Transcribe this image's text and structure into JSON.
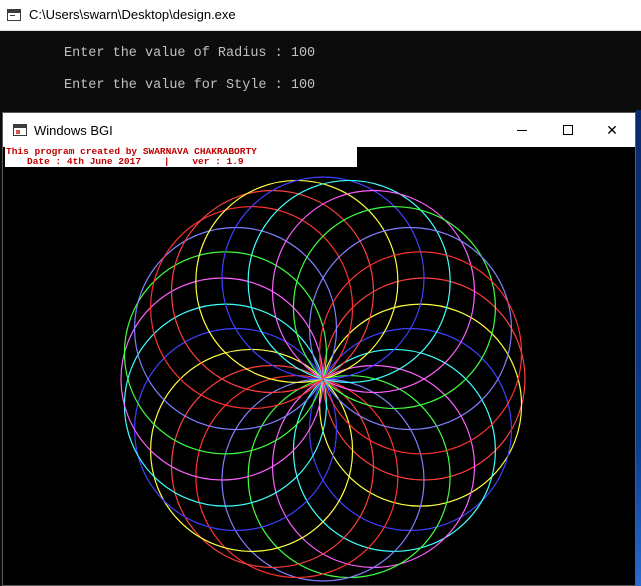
{
  "console": {
    "title": "C:\\Users\\swarn\\Desktop\\design.exe",
    "lines": [
      "Enter the value of Radius : 100",
      "Enter the value for Style : 100"
    ]
  },
  "bgi": {
    "title": "Windows BGI",
    "credit_line1": "This program created by SWARNAVA CHAKRABORTY",
    "credit_line2": "Date : 4th June 2017    |    ver : 1.9",
    "colors": [
      "#ff4040",
      "#ffff40",
      "#4040ff",
      "#40ffff",
      "#ff60ff",
      "#40ff40",
      "#8080ff",
      "#ff3030"
    ]
  }
}
